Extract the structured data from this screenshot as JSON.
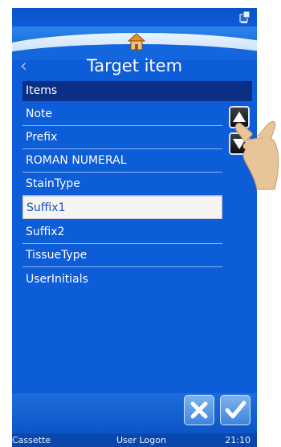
{
  "title": "Target item",
  "list": {
    "header": "Items",
    "items": [
      {
        "label": "Note"
      },
      {
        "label": "Prefix"
      },
      {
        "label": "ROMAN NUMERAL"
      },
      {
        "label": "StainType"
      },
      {
        "label": "Suffix1",
        "selected": true
      },
      {
        "label": "Suffix2"
      },
      {
        "label": "TissueType"
      },
      {
        "label": "UserInitials"
      }
    ]
  },
  "status_bar": {
    "mode": "Cassette",
    "user": "User Logon",
    "time": "21:10"
  },
  "icons": {
    "home": "home-icon",
    "back": "back-arrow-icon",
    "scroll_up": "scroll-up-icon",
    "scroll_down": "scroll-down-icon",
    "cancel": "cancel-x-icon",
    "confirm": "confirm-check-icon",
    "network": "network-status-icon",
    "pointer": "pointing-hand-icon"
  },
  "colors": {
    "background": "#0d5cd8",
    "list_header": "#0a2f84",
    "selected_row": "#f4f4f4"
  }
}
